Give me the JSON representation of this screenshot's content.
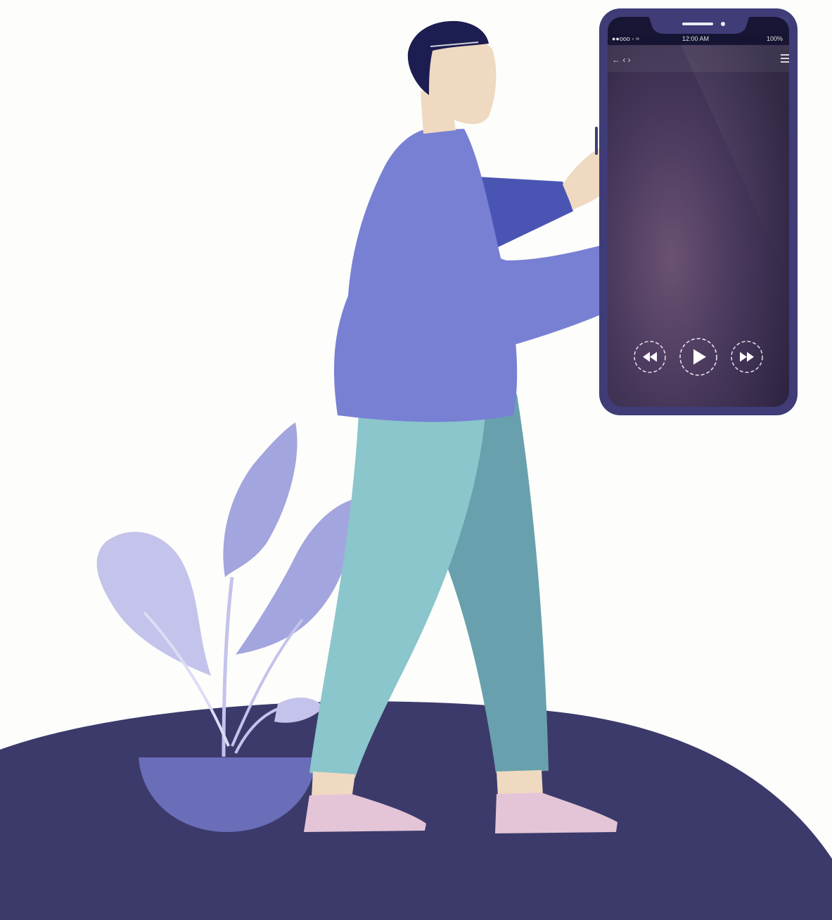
{
  "phone": {
    "status_bar": {
      "carrier": "●●ooo ◦ ≈",
      "time": "12:00 AM",
      "battery": "100%"
    },
    "header_left": "← ‹ ›",
    "menu_icon": "menu-icon",
    "controls": [
      "rewind-icon",
      "play-icon",
      "fast-forward-icon"
    ]
  },
  "colors": {
    "background": "#fdfdfb",
    "ground": "#3c3a6b",
    "sweater": "#7880d4",
    "sleeve_dark": "#4a55b3",
    "pants_light": "#8ac6cb",
    "pants_dark": "#68a1ad",
    "skin": "#efd9c1",
    "hair": "#1c1d50",
    "shoes": "#e3c5d7",
    "pot": "#6a6db8",
    "leaf_light": "#c3c3ec",
    "leaf_mid": "#a3a5de",
    "phone_frame": "#3f3c78"
  }
}
